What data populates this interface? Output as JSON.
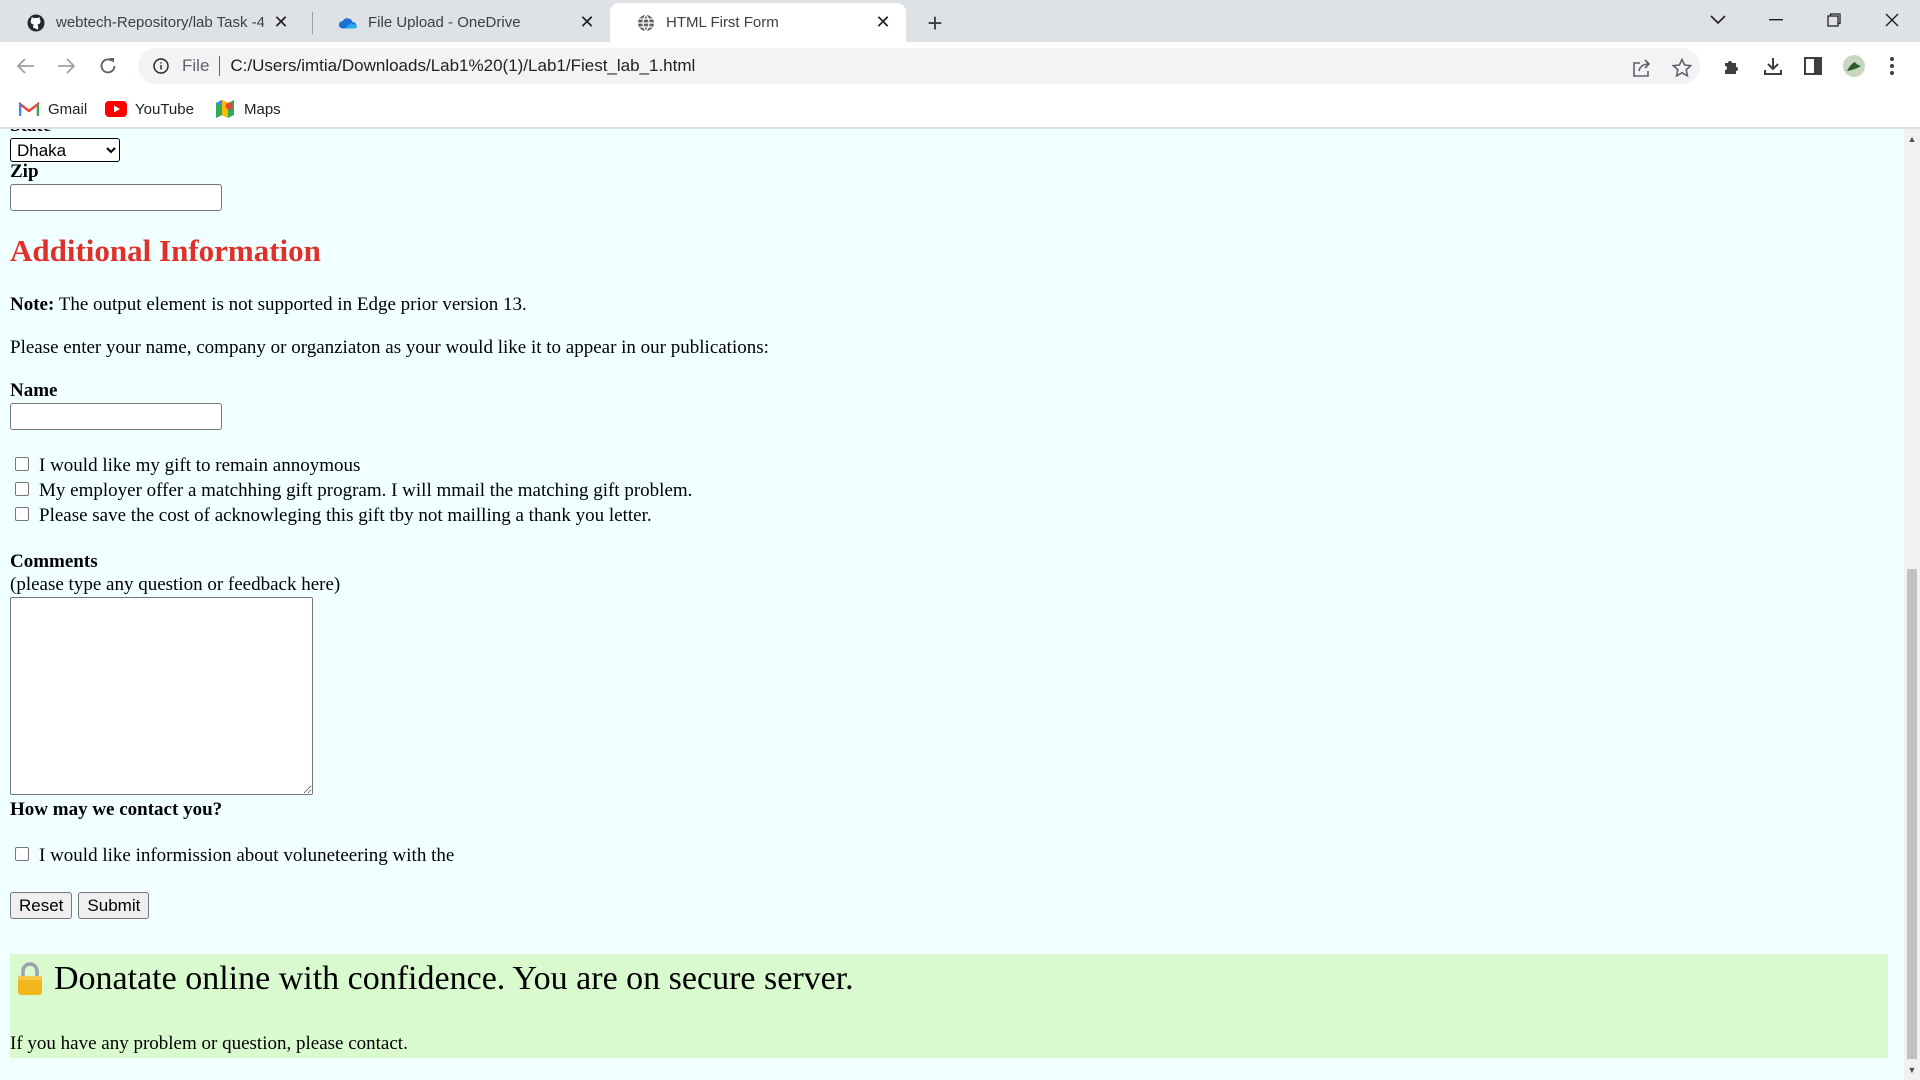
{
  "tabs": [
    {
      "title": "webtech-Repository/lab Task -4 a",
      "favicon": "github-icon"
    },
    {
      "title": "File Upload - OneDrive",
      "favicon": "onedrive-icon"
    },
    {
      "title": "HTML First Form",
      "favicon": "globe-icon",
      "active": true
    }
  ],
  "toolbar": {
    "scheme": "File",
    "url": "C:/Users/imtia/Downloads/Lab1%20(1)/Lab1/Fiest_lab_1.html"
  },
  "bookmarks": [
    {
      "label": "Gmail",
      "icon": "gmail-icon"
    },
    {
      "label": "YouTube",
      "icon": "youtube-icon"
    },
    {
      "label": "Maps",
      "icon": "maps-icon"
    }
  ],
  "form": {
    "state_label": "State",
    "state_value": "Dhaka",
    "zip_label": "Zip",
    "zip_value": "",
    "heading": "Additional Information",
    "note_bold": "Note:",
    "note_text": " The output element is not supported in Edge prior version 13.",
    "instruction": "Please enter your name, company or organziaton as your would like it to appear in our publications:",
    "name_label": "Name",
    "name_value": "",
    "checkboxes": [
      "I would like my gift to remain annoymous",
      "My employer offer a matchhing gift program. I will mmail the matching gift problem.",
      "Please save the cost of acknowleging this gift tby not mailling a thank you letter."
    ],
    "comments_label": "Comments",
    "comments_hint": "(please type any question or feedback here)",
    "comments_value": "",
    "contact_label": "How may we contact you?",
    "contact_checkbox": "I would like informission about voluneteering with the",
    "reset_label": "Reset",
    "submit_label": "Submit"
  },
  "secure_banner": {
    "headline": "Donatate online with confidence. You are on secure server.",
    "footer": "If you have any problem or question, please contact."
  },
  "colors": {
    "page_bg": "#f0ffff",
    "heading_red": "#e0302a",
    "banner_green": "#d9f9cf"
  }
}
